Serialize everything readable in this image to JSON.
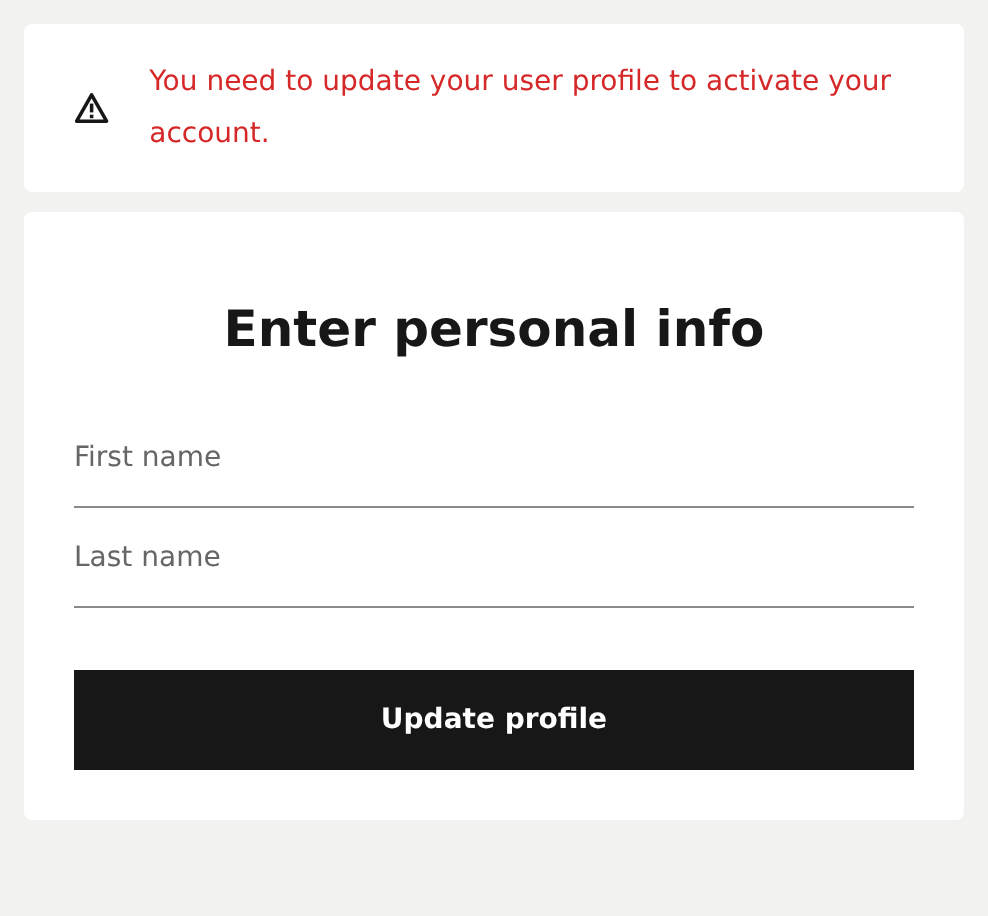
{
  "alert": {
    "message": "You need to update your user profile to activate your account."
  },
  "form": {
    "title": "Enter personal info",
    "fields": [
      {
        "placeholder": "First name"
      },
      {
        "placeholder": "Last name"
      }
    ],
    "submit": "Update profile"
  }
}
